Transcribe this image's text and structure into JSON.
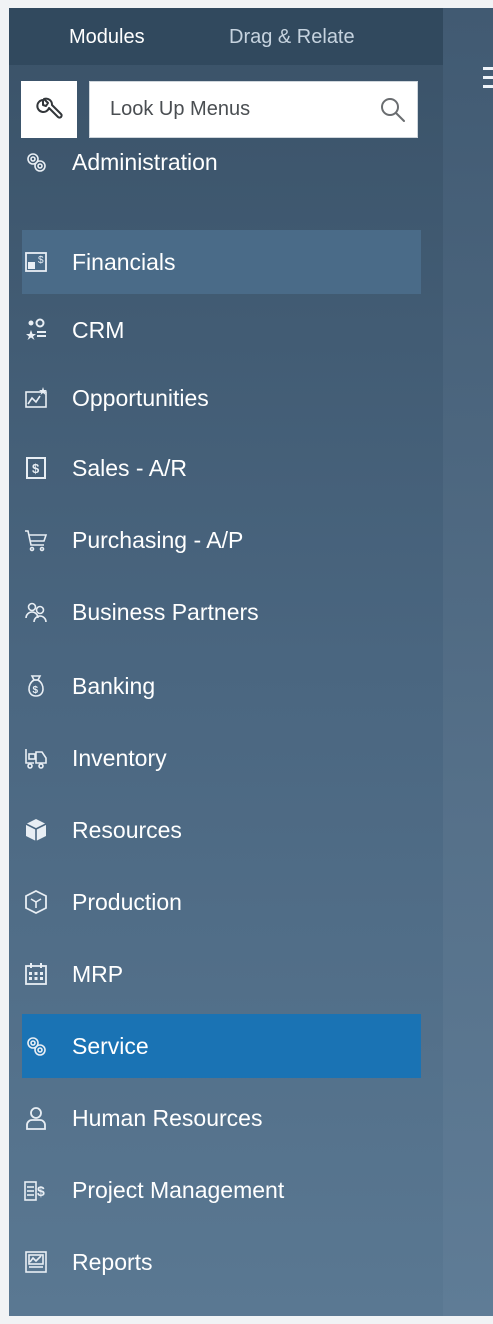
{
  "tabs": {
    "modules": "Modules",
    "drag_relate": "Drag & Relate"
  },
  "search": {
    "placeholder": "Look Up Menus"
  },
  "menu": {
    "items": [
      {
        "label": "Administration",
        "icon": "gears-icon"
      },
      {
        "label": "Financials",
        "icon": "ledger-icon"
      },
      {
        "label": "CRM",
        "icon": "crm-icon"
      },
      {
        "label": "Opportunities",
        "icon": "chart-star-icon"
      },
      {
        "label": "Sales - A/R",
        "icon": "dollar-box-icon"
      },
      {
        "label": "Purchasing - A/P",
        "icon": "cart-icon"
      },
      {
        "label": "Business Partners",
        "icon": "partners-icon"
      },
      {
        "label": "Banking",
        "icon": "money-bag-icon"
      },
      {
        "label": "Inventory",
        "icon": "forklift-icon"
      },
      {
        "label": "Resources",
        "icon": "cube-icon"
      },
      {
        "label": "Production",
        "icon": "hexagon-icon"
      },
      {
        "label": "MRP",
        "icon": "calendar-icon"
      },
      {
        "label": "Service",
        "icon": "gears-icon"
      },
      {
        "label": "Human Resources",
        "icon": "person-icon"
      },
      {
        "label": "Project Management",
        "icon": "project-icon"
      },
      {
        "label": "Reports",
        "icon": "report-icon"
      }
    ],
    "hover_index": 1,
    "selected_index": 12
  },
  "colors": {
    "sidebar_top": "#3a5268",
    "sidebar_bottom": "#5a7892",
    "selected": "#1a73b4",
    "hover": "#4a6b88"
  }
}
